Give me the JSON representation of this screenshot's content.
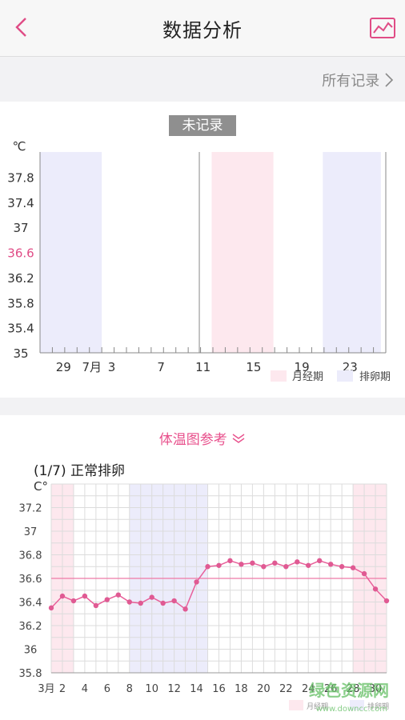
{
  "header": {
    "title": "数据分析",
    "back_icon": "chevron-left-icon",
    "trend_icon": "trend-chart-icon",
    "accent": "#e04c86"
  },
  "records_link": "所有记录",
  "chart_data": [
    {
      "type": "line",
      "title": "未记录",
      "ylabel": "℃",
      "yticks": [
        35,
        35.4,
        35.8,
        36.2,
        36.6,
        37,
        37.4,
        37.8
      ],
      "highlight_tick": 36.6,
      "ylim": [
        35,
        38.2
      ],
      "x_tick_labels": [
        "29",
        "7月",
        "3",
        "7",
        "11",
        "15",
        "19",
        "23"
      ],
      "legend": [
        {
          "label": "月经期",
          "color": "#fde8ee"
        },
        {
          "label": "排卵期",
          "color": "#ececfb"
        }
      ],
      "series": []
    },
    {
      "type": "line",
      "reference_title": "体温图参考",
      "subtitle": "(1/7) 正常排卵",
      "ylabel": "C°",
      "yticks": [
        35.8,
        36,
        36.2,
        36.4,
        36.6,
        36.8,
        37,
        37.2
      ],
      "ylim": [
        35.8,
        37.4
      ],
      "x_tick_labels": [
        "3月",
        "2",
        "4",
        "6",
        "8",
        "10",
        "12",
        "14",
        "16",
        "18",
        "20",
        "22",
        "24",
        "26",
        "28",
        "30"
      ],
      "x": [
        1,
        2,
        3,
        4,
        5,
        6,
        7,
        8,
        9,
        10,
        11,
        12,
        13,
        14,
        15,
        16,
        17,
        18,
        19,
        20,
        21,
        22,
        23,
        24,
        25,
        26,
        27,
        28,
        29,
        30,
        31
      ],
      "values": [
        36.35,
        36.45,
        36.41,
        36.45,
        36.37,
        36.42,
        36.46,
        36.4,
        36.39,
        36.44,
        36.39,
        36.41,
        36.34,
        36.57,
        36.7,
        36.71,
        36.75,
        36.72,
        36.73,
        36.7,
        36.73,
        36.7,
        36.74,
        36.71,
        36.75,
        36.72,
        36.7,
        36.69,
        36.64,
        36.51,
        36.41
      ],
      "baseline": 36.6,
      "legend": [
        {
          "label": "月经期",
          "color": "#fde8ee"
        },
        {
          "label": "排卵期",
          "color": "#ececfb"
        }
      ]
    }
  ],
  "watermark": {
    "text": "绿色资源网",
    "url": "www.downcc.com"
  }
}
